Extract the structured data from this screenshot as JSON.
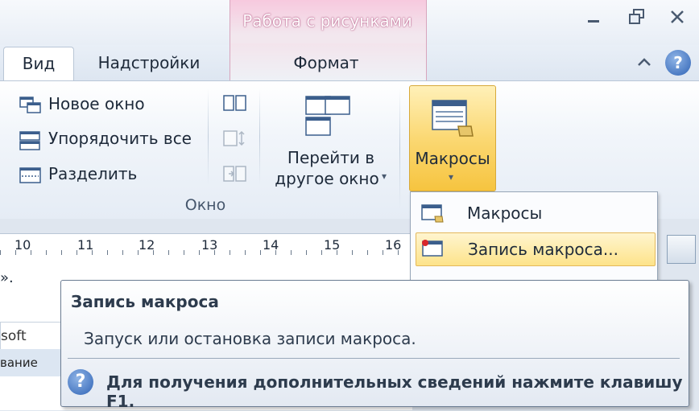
{
  "context_tab": {
    "title": "Работа с рисунками",
    "tab": "Формат"
  },
  "tabs": [
    {
      "label": "Вид"
    },
    {
      "label": "Надстройки"
    }
  ],
  "ribbon": {
    "window_group": {
      "label": "Окно",
      "new_window": "Новое окно",
      "arrange_all": "Упорядочить все",
      "split": "Разделить",
      "switch_window_line1": "Перейти в",
      "switch_window_line2": "другое окно"
    },
    "macros_button": "Макросы"
  },
  "dropdown": {
    "items": [
      {
        "label": "Макросы"
      },
      {
        "label": "Запись макроса..."
      }
    ]
  },
  "ruler": {
    "ticks": [
      "10",
      "11",
      "12",
      "13",
      "14",
      "15",
      "16"
    ]
  },
  "doc": {
    "text_fragment": "»."
  },
  "left_panel": {
    "item1": "soft Word",
    "item2": "вание"
  },
  "tooltip": {
    "title": "Запись макроса",
    "description": "Запуск или остановка записи макроса.",
    "help": "Для получения дополнительных сведений нажмите клавишу F1."
  }
}
